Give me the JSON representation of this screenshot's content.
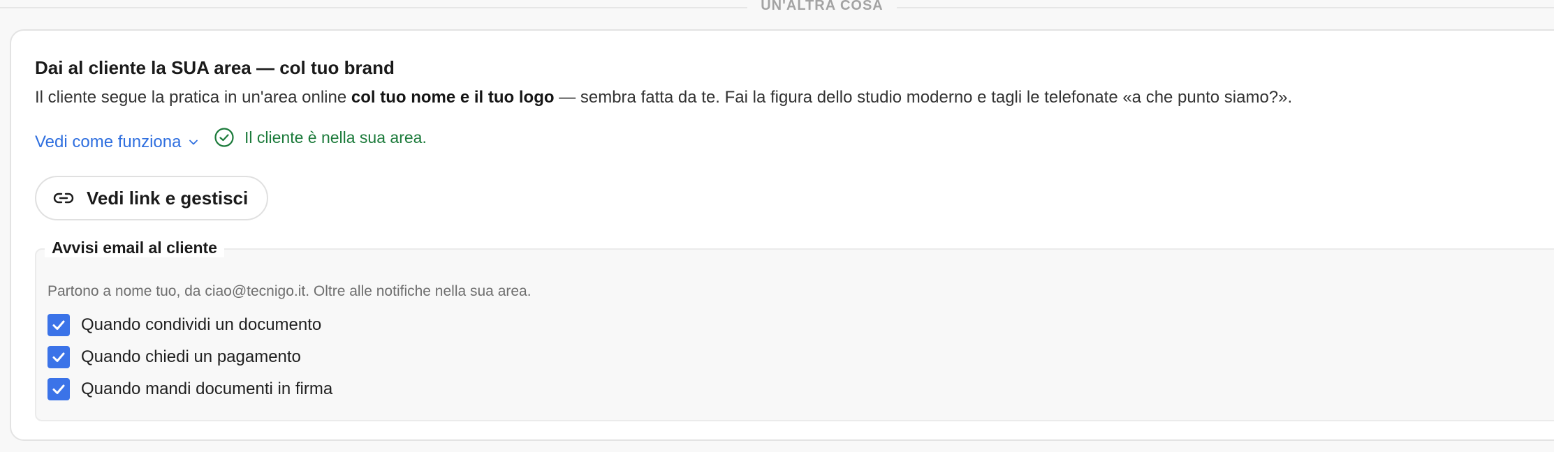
{
  "divider": {
    "label": "UN'ALTRA COSA"
  },
  "card": {
    "title": "Dai al cliente la SUA area — col tuo brand",
    "description": {
      "prefix": "Il cliente segue la pratica in un'area online ",
      "bold": "col tuo nome e il tuo logo",
      "suffix": " — sembra fatta da te. Fai la figura dello studio moderno e tagli le telefonate «a che punto siamo?»."
    },
    "how_link_label": "Vedi come funziona",
    "status_text": "Il cliente è nella sua area.",
    "manage_button_label": "Vedi link e gestisci"
  },
  "notifications": {
    "legend": "Avvisi email al cliente",
    "description": "Partono a nome tuo, da ciao@tecnigo.it. Oltre alle notifiche nella sua area.",
    "options": [
      {
        "label": "Quando condividi un documento",
        "checked": true
      },
      {
        "label": "Quando chiedi un pagamento",
        "checked": true
      },
      {
        "label": "Quando mandi documenti in firma",
        "checked": true
      }
    ]
  },
  "colors": {
    "accent": "#3b73e8",
    "link": "#2f6fdf",
    "success": "#1b7a3a",
    "muted": "#6e6e6e"
  },
  "icons": {
    "chevron": "chevron-down-icon",
    "status": "check-circle-icon",
    "button": "link-icon",
    "checkbox": "checkmark-icon"
  }
}
